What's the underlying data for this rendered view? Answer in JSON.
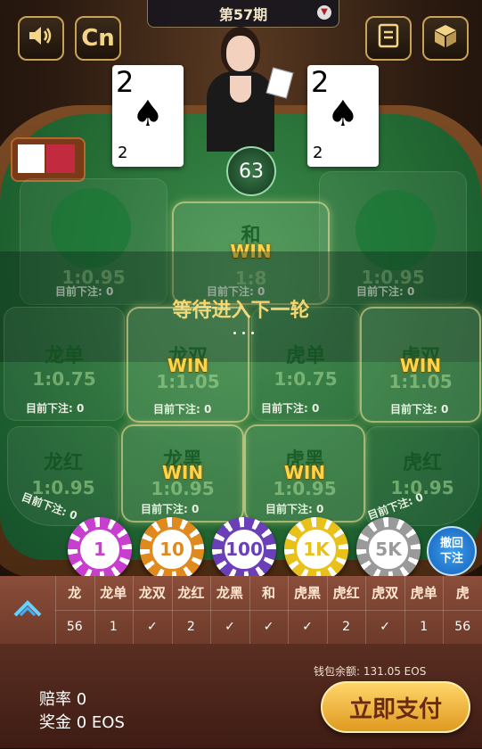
{
  "header": {
    "period_label": "第57期",
    "dropdown_icon": "chevron-down-icon"
  },
  "top_buttons": {
    "sound": "speaker-icon",
    "language": "Cn",
    "history": "record-book-icon",
    "box": "cube-icon"
  },
  "cards": {
    "left": {
      "rank": "2",
      "suit": "♠",
      "small": "2"
    },
    "right": {
      "rank": "2",
      "suit": "♠",
      "small": "2"
    }
  },
  "countdown": "63",
  "status_message": "等待进入下一轮",
  "win_label": "WIN",
  "bet_prefix": "目前下注: ",
  "regions": {
    "dragon": {
      "odds": "1:0.95",
      "bet": "0"
    },
    "tie": {
      "name": "和",
      "odds": "1:8",
      "bet": "0"
    },
    "tiger": {
      "odds": "1:0.95",
      "bet": "0"
    },
    "dragon_odd": {
      "name": "龙单",
      "odds": "1:0.75",
      "bet": "0"
    },
    "dragon_even": {
      "name": "龙双",
      "odds": "1:1.05",
      "bet": "0"
    },
    "tiger_odd": {
      "name": "虎单",
      "odds": "1:0.75",
      "bet": "0"
    },
    "tiger_even": {
      "name": "虎双",
      "odds": "1:1.05",
      "bet": "0"
    },
    "dragon_red": {
      "name": "龙红",
      "odds": "1:0.95",
      "bet": "0"
    },
    "dragon_black": {
      "name": "龙黑",
      "odds": "1:0.95",
      "bet": "0"
    },
    "tiger_black": {
      "name": "虎黑",
      "odds": "1:0.95",
      "bet": "0"
    },
    "tiger_red": {
      "name": "虎红",
      "odds": "1:0.95",
      "bet": "0"
    }
  },
  "chips": [
    {
      "label": "1",
      "color": "#c83fd0"
    },
    {
      "label": "10",
      "color": "#e08a1e"
    },
    {
      "label": "100",
      "color": "#6a3fb8"
    },
    {
      "label": "1K",
      "color": "#e8c21a"
    },
    {
      "label": "5K",
      "color": "#9a9a9a"
    }
  ],
  "undo_button": {
    "line1": "撤回",
    "line2": "下注"
  },
  "history": {
    "toggle_icon": "chevron-up-icon",
    "columns": [
      "龙",
      "龙单",
      "龙双",
      "龙红",
      "龙黑",
      "和",
      "虎黑",
      "虎红",
      "虎双",
      "虎单",
      "虎"
    ],
    "values": [
      "56",
      "1",
      "✓",
      "2",
      "✓",
      "✓",
      "✓",
      "2",
      "✓",
      "1",
      "56"
    ]
  },
  "footer": {
    "wallet_label": "钱包余额: ",
    "wallet_value": "131.05 EOS",
    "rate_label": "赔率",
    "rate_value": "0",
    "prize_label": "奖金",
    "prize_value": "0 EOS",
    "pay_button": "立即支付"
  },
  "colors": {
    "felt": "#236a33",
    "gold": "#ffd34a",
    "pay_button": "#f2b23a"
  }
}
